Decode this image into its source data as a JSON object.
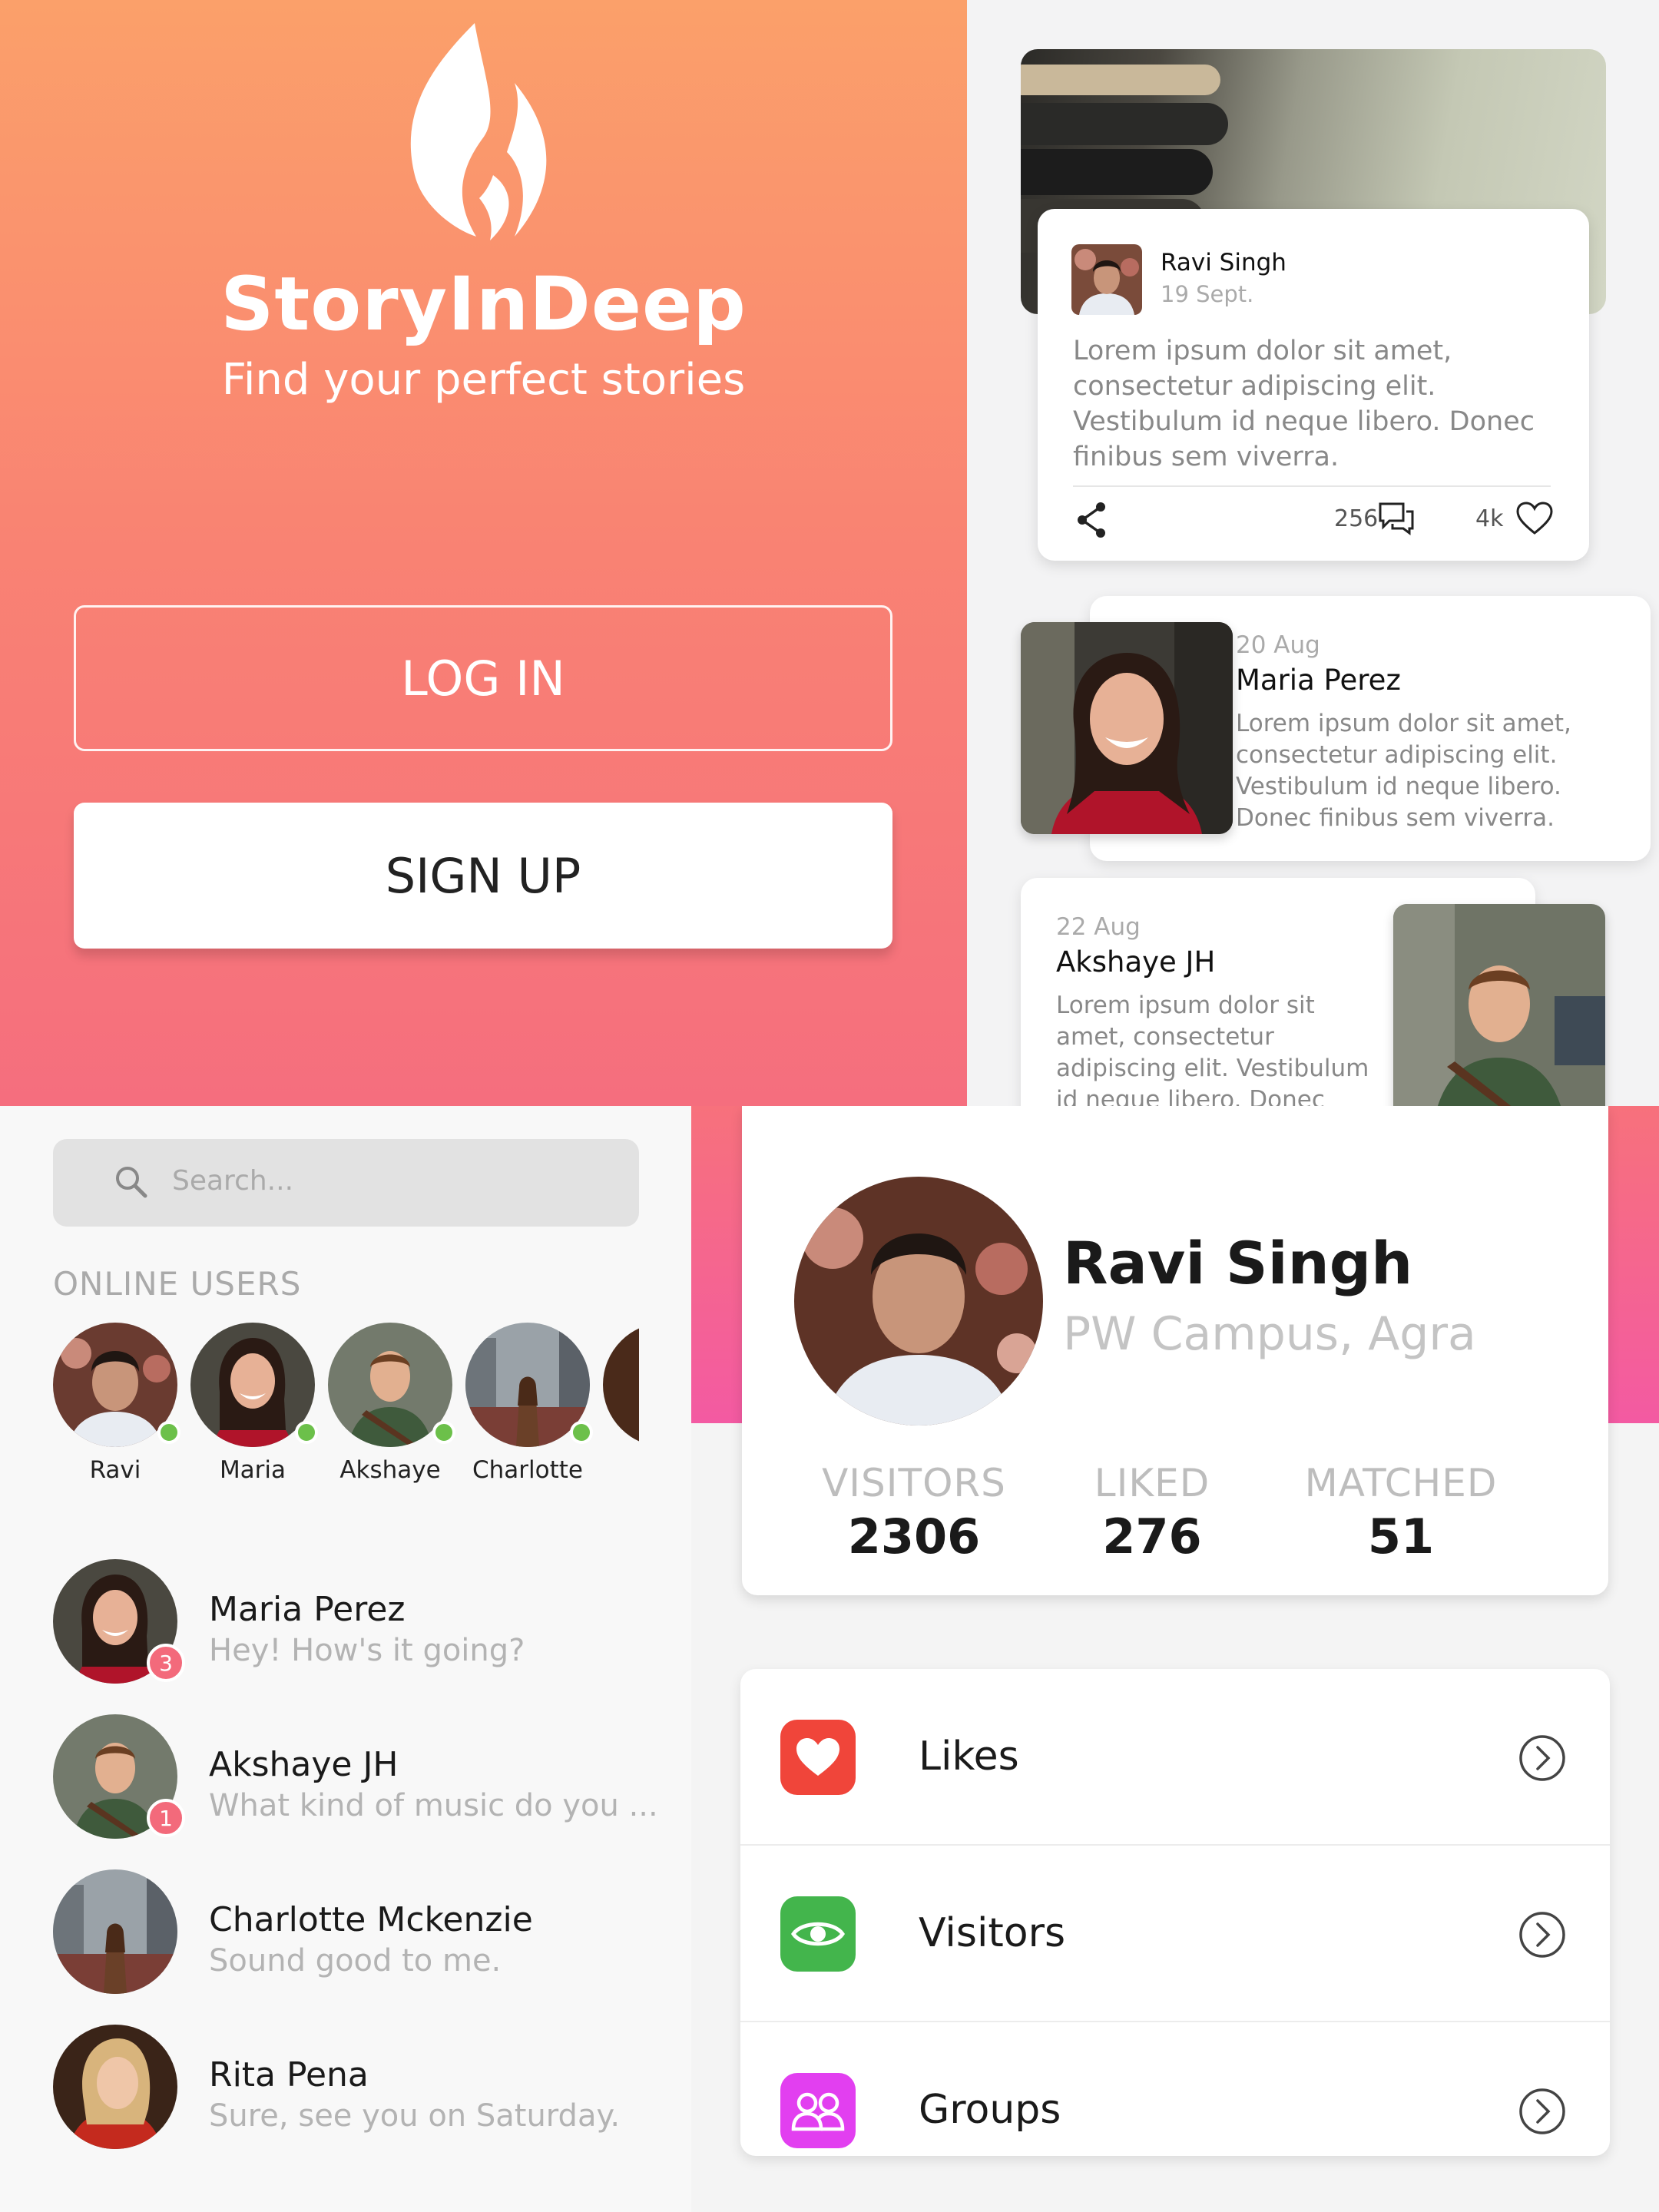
{
  "splash": {
    "app_name": "StoryInDeep",
    "tagline": "Find your perfect stories",
    "login_label": "LOG IN",
    "signup_label": "SIGN UP",
    "colors": {
      "gradient_top": "#fba06a",
      "gradient_bottom": "#f56e7e"
    }
  },
  "feed": {
    "post": {
      "author": "Ravi Singh",
      "date": "19 Sept.",
      "text": "Lorem ipsum dolor sit amet, consectetur adipiscing elit. Vestibulum id neque libero. Donec finibus sem viverra.",
      "comments": "256",
      "likes": "4k",
      "icons": [
        "share-icon",
        "comment-icon",
        "heart-icon"
      ]
    },
    "stories": [
      {
        "date": "20 Aug",
        "name": "Maria Perez",
        "text": "Lorem ipsum dolor sit amet, consectetur adipiscing elit. Vestibulum id neque libero. Donec finibus sem viverra."
      },
      {
        "date": "22 Aug",
        "name": "Akshaye JH",
        "text": "Lorem ipsum dolor sit amet, consectetur adipiscing elit. Vestibulum id neque libero. Donec"
      }
    ]
  },
  "chat": {
    "search_placeholder": "Search...",
    "online_heading": "ONLINE USERS",
    "online_users": [
      {
        "name": "Ravi"
      },
      {
        "name": "Maria"
      },
      {
        "name": "Akshaye"
      },
      {
        "name": "Charlotte"
      }
    ],
    "conversations": [
      {
        "name": "Maria Perez",
        "message": "Hey! How's it going?",
        "unread": "3"
      },
      {
        "name": "Akshaye JH",
        "message": "What kind of music do you ...",
        "unread": "1"
      },
      {
        "name": "Charlotte Mckenzie",
        "message": "Sound good to me.",
        "unread": ""
      },
      {
        "name": "Rita Pena",
        "message": "Sure, see you on Saturday.",
        "unread": ""
      }
    ],
    "colors": {
      "online": "#6cc04a",
      "badge": "#f36a7b"
    }
  },
  "profile": {
    "name": "Ravi Singh",
    "location": "PW Campus, Agra",
    "stats": [
      {
        "label": "VISITORS",
        "value": "2306"
      },
      {
        "label": "LIKED",
        "value": "276"
      },
      {
        "label": "MATCHED",
        "value": "51"
      }
    ],
    "menu": [
      {
        "label": "Likes",
        "icon": "heart-icon",
        "color": "#f0453a"
      },
      {
        "label": "Visitors",
        "icon": "eye-icon",
        "color": "#43b54c"
      },
      {
        "label": "Groups",
        "icon": "groups-icon",
        "color": "#e23ff0"
      }
    ]
  }
}
